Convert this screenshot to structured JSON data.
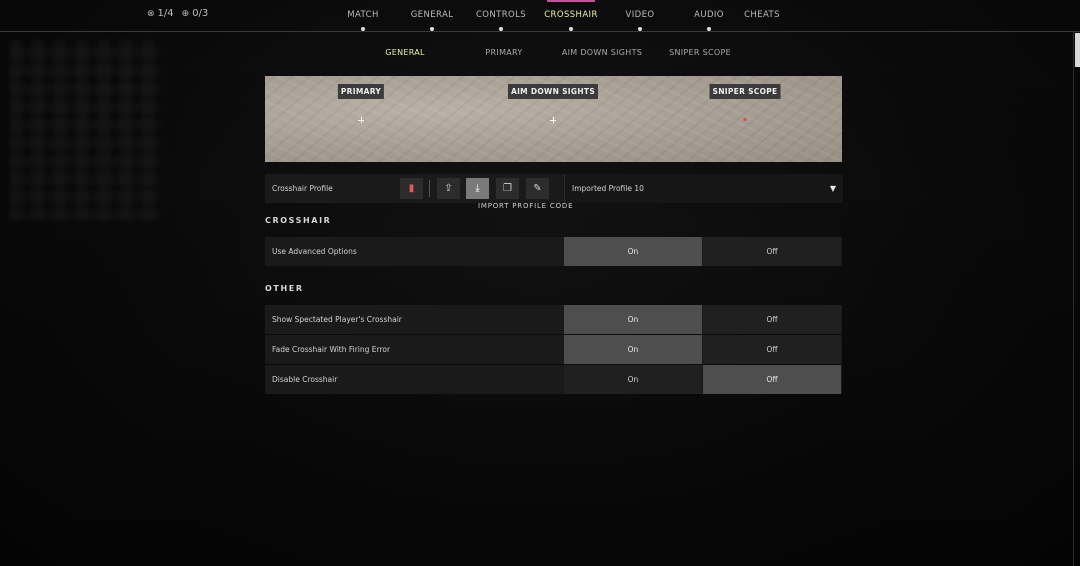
{
  "status": {
    "counter1": "1/4",
    "counter2": "0/3",
    "counter1_icon": "target-icon",
    "counter2_icon": "plus-circle-icon"
  },
  "main_nav": {
    "items": [
      "MATCH",
      "GENERAL",
      "CONTROLS",
      "CROSSHAIR",
      "VIDEO",
      "AUDIO",
      "CHEATS"
    ],
    "active": "CROSSHAIR"
  },
  "sub_nav": {
    "items": [
      "GENERAL",
      "PRIMARY",
      "AIM DOWN SIGHTS",
      "SNIPER SCOPE"
    ],
    "active": "GENERAL"
  },
  "preview": {
    "labels": [
      "PRIMARY",
      "AIM DOWN SIGHTS",
      "SNIPER SCOPE"
    ]
  },
  "profile": {
    "label": "Crosshair Profile",
    "selected": "Imported Profile 10",
    "tooltip": "IMPORT PROFILE CODE",
    "tools": [
      "delete-icon",
      "export-icon",
      "import-icon",
      "copy-icon",
      "rename-icon"
    ]
  },
  "sections": {
    "crosshair_title": "CROSSHAIR",
    "other_title": "OTHER"
  },
  "options": {
    "on_label": "On",
    "off_label": "Off",
    "advanced": {
      "label": "Use Advanced Options",
      "value": "On"
    },
    "spectated": {
      "label": "Show Spectated Player's Crosshair",
      "value": "On"
    },
    "fade": {
      "label": "Fade Crosshair With Firing Error",
      "value": "On"
    },
    "disable": {
      "label": "Disable Crosshair",
      "value": "Off"
    }
  },
  "colors": {
    "accent_active": "#e8f2a3",
    "nav_accent": "#c64f9e",
    "selected_option": "#4e4e4f"
  }
}
